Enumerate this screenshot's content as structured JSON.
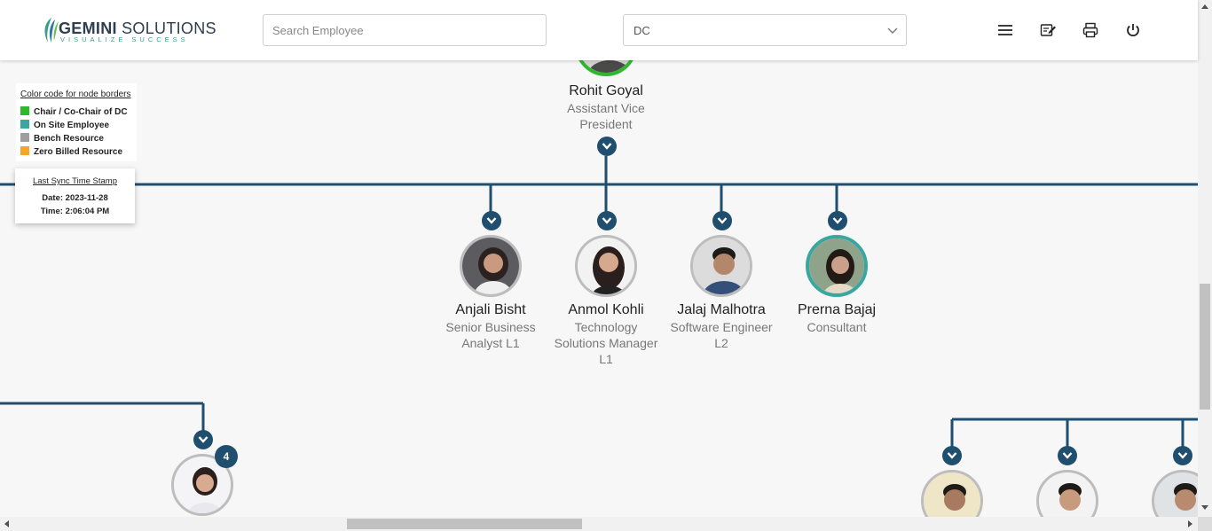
{
  "header": {
    "logo_main_bold": "GEMINI",
    "logo_main_rest": " SOLUTIONS",
    "logo_tagline": "VISUALIZE SUCCESS",
    "search_placeholder": "Search Employee",
    "dept_select_value": "DC",
    "icons": [
      "menu-icon",
      "edit-note-icon",
      "print-icon",
      "power-icon"
    ]
  },
  "legend": {
    "title": "Color code for node borders",
    "items": [
      {
        "label": "Chair / Co-Chair of DC",
        "color": "#2eb82e"
      },
      {
        "label": "On Site Employee",
        "color": "#3aa6a0"
      },
      {
        "label": "Bench Resource",
        "color": "#9e9e9e"
      },
      {
        "label": "Zero Billed Resource",
        "color": "#f5a623"
      }
    ]
  },
  "sync": {
    "title": "Last Sync Time Stamp",
    "date": "Date: 2023-11-28",
    "time": "Time: 2:06:04 PM"
  },
  "tree": {
    "line_color": "#1f4e6e",
    "parent": {
      "name": "Rohit Goyal",
      "title_lines": [
        "Assistant Vice",
        "President"
      ],
      "border": "#2eb82e"
    },
    "children": [
      {
        "name": "Anjali Bisht",
        "title_lines": [
          "Senior Business",
          "Analyst L1"
        ],
        "border": "#bdbdbd"
      },
      {
        "name": "Anmol Kohli",
        "title_lines": [
          "Technology",
          "Solutions Manager",
          "L1"
        ],
        "border": "#bdbdbd"
      },
      {
        "name": "Jalaj Malhotra",
        "title_lines": [
          "Software Engineer",
          "L2"
        ],
        "border": "#bdbdbd"
      },
      {
        "name": "Prerna Bajaj",
        "title_lines": [
          "Consultant"
        ],
        "border": "#3aa6a0"
      }
    ],
    "lower_left_badge": "4"
  }
}
